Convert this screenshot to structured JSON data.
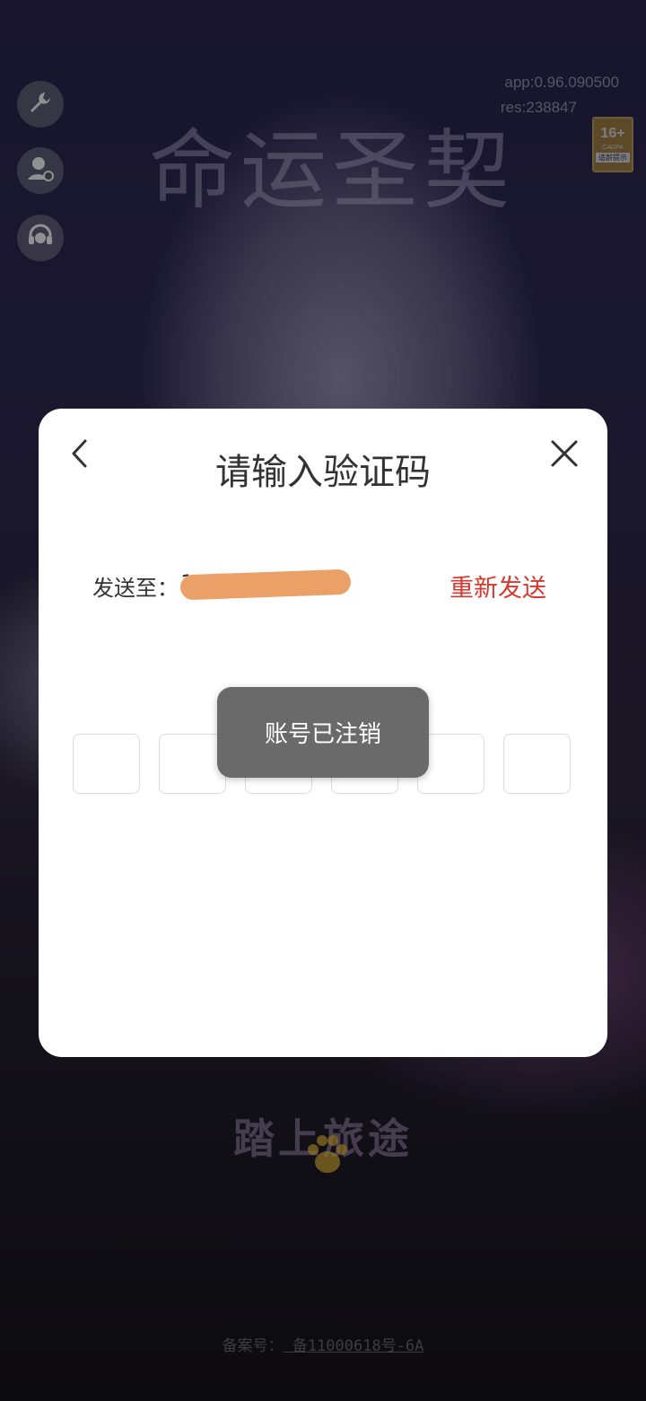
{
  "background": {
    "game_logo_text": "命运圣契",
    "start_button_text": "踏上旅途",
    "license_label": "备案号：",
    "license_value": "  备11000618号-6A",
    "version": {
      "app": "app:0.96.090500",
      "res": "res:238847"
    },
    "age_rating": {
      "age": "16+",
      "org": "CADPA",
      "tip": "适龄提示"
    },
    "side_buttons": [
      {
        "icon": "wrench-icon"
      },
      {
        "icon": "user-settings-icon"
      },
      {
        "icon": "headset-icon"
      }
    ]
  },
  "dialog": {
    "title": "请输入验证码",
    "send_label": "发送至：",
    "phone_value": "1",
    "resend_label": "重新发送",
    "code_boxes": [
      "",
      "",
      "",
      "",
      "",
      ""
    ],
    "back_icon": "chevron-left-icon",
    "close_icon": "close-icon"
  },
  "toast": {
    "message": "账号已注销"
  },
  "colors": {
    "accent_red": "#d8372d",
    "redaction": "#eaa066",
    "toast_bg": "#5f5f5f"
  }
}
